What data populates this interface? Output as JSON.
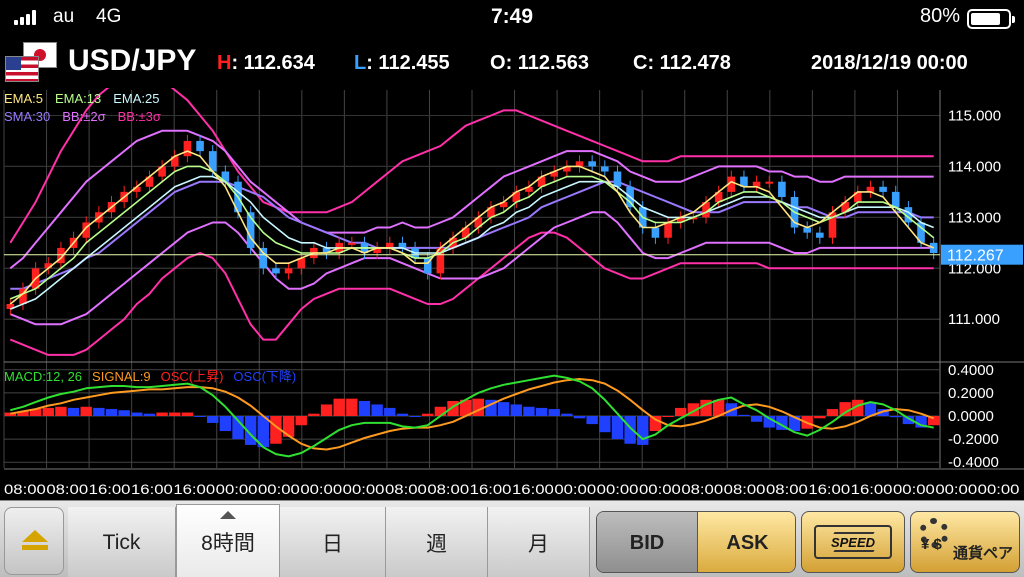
{
  "status_bar": {
    "carrier": "au",
    "network": "4G",
    "time": "7:49",
    "battery_percent": "80%",
    "battery_level": 0.8
  },
  "header": {
    "pair": "USD/JPY",
    "high_key": "H",
    "high": ": 112.634",
    "low_key": "L",
    "low": ": 112.455",
    "open_key": "O",
    "open": ": 112.563",
    "close_key": "C",
    "close": ": 112.478",
    "datetime": "2018/12/19 00:00",
    "colors": {
      "high": "#ff2020",
      "low": "#3aa0ff",
      "open": "#ffffff",
      "close": "#ffffff"
    }
  },
  "indicators": {
    "row1": [
      {
        "label": "EMA:5",
        "color": "#ffe680"
      },
      {
        "label": "EMA:13",
        "color": "#b8ff8c"
      },
      {
        "label": "EMA:25",
        "color": "#c8f8ff"
      }
    ],
    "row2": [
      {
        "label": "SMA:30",
        "color": "#9a78ff"
      },
      {
        "label": "BB:±2σ",
        "color": "#e070ff"
      },
      {
        "label": "BB:±3σ",
        "color": "#ff30a8"
      }
    ],
    "macd_legend": [
      {
        "label": "MACD:12, 26",
        "color": "#30e030"
      },
      {
        "label": "SIGNAL:9",
        "color": "#ff9a20"
      },
      {
        "label": "OSC(上昇)",
        "color": "#ff2020"
      },
      {
        "label": "OSC(下降)",
        "color": "#2040ff"
      }
    ]
  },
  "chart_data": {
    "type": "line",
    "price_axis": {
      "min": 110.2,
      "max": 115.5,
      "ticks": [
        "115.000",
        "114.000",
        "113.000",
        "112.000",
        "111.000"
      ],
      "tick_values": [
        115,
        114,
        113,
        112,
        111
      ]
    },
    "current_price": "112.267",
    "current_price_value": 112.267,
    "time_labels": [
      "08:00",
      "08:00",
      "16:00",
      "16:00",
      "16:00",
      "00:00",
      "00:00",
      "00:00",
      "00:00",
      "08:00",
      "08:00",
      "16:00",
      "16:00",
      "00:00",
      "00:00",
      "00:00",
      "08:00",
      "08:00",
      "08:00",
      "16:00",
      "16:00",
      "00:00",
      "00:00",
      "00:00"
    ],
    "close": [
      111.3,
      111.6,
      112.0,
      112.1,
      112.4,
      112.6,
      112.9,
      113.1,
      113.3,
      113.5,
      113.6,
      113.8,
      114.0,
      114.2,
      114.5,
      114.3,
      113.9,
      113.7,
      113.1,
      112.4,
      112.0,
      111.9,
      112.0,
      112.2,
      112.4,
      112.3,
      112.5,
      112.5,
      112.3,
      112.4,
      112.5,
      112.4,
      112.2,
      111.9,
      112.4,
      112.6,
      112.8,
      113.0,
      113.2,
      113.3,
      113.5,
      113.6,
      113.8,
      113.9,
      114.0,
      114.1,
      114.0,
      113.9,
      113.6,
      113.2,
      112.8,
      112.6,
      112.9,
      113.0,
      113.0,
      113.3,
      113.5,
      113.8,
      113.6,
      113.7,
      113.7,
      113.4,
      112.8,
      112.7,
      112.6,
      113.1,
      113.3,
      113.5,
      113.6,
      113.5,
      113.2,
      112.9,
      112.5,
      112.3
    ],
    "ema_5": [
      111.3,
      111.5,
      111.8,
      112.0,
      112.2,
      112.5,
      112.8,
      113.0,
      113.2,
      113.4,
      113.6,
      113.8,
      114.0,
      114.2,
      114.3,
      114.2,
      113.9,
      113.6,
      113.1,
      112.6,
      112.3,
      112.1,
      112.1,
      112.2,
      112.3,
      112.3,
      112.4,
      112.4,
      112.3,
      112.4,
      112.4,
      112.3,
      112.1,
      112.1,
      112.4,
      112.6,
      112.8,
      113.0,
      113.2,
      113.3,
      113.5,
      113.6,
      113.8,
      113.9,
      114.0,
      114.0,
      113.9,
      113.8,
      113.5,
      113.1,
      112.8,
      112.8,
      112.9,
      113.0,
      113.1,
      113.3,
      113.5,
      113.7,
      113.6,
      113.6,
      113.5,
      113.2,
      112.9,
      112.8,
      112.9,
      113.1,
      113.3,
      113.5,
      113.5,
      113.4,
      113.1,
      112.8,
      112.5,
      112.4
    ],
    "ema_13": [
      111.4,
      111.5,
      111.6,
      111.8,
      112.0,
      112.2,
      112.5,
      112.7,
      112.9,
      113.1,
      113.3,
      113.5,
      113.7,
      113.9,
      114.0,
      114.0,
      113.9,
      113.7,
      113.4,
      113.0,
      112.7,
      112.5,
      112.4,
      112.3,
      112.3,
      112.3,
      112.3,
      112.4,
      112.4,
      112.4,
      112.4,
      112.3,
      112.2,
      112.2,
      112.3,
      112.5,
      112.6,
      112.8,
      113.0,
      113.1,
      113.3,
      113.4,
      113.6,
      113.7,
      113.8,
      113.8,
      113.8,
      113.7,
      113.5,
      113.3,
      113.0,
      112.9,
      112.9,
      112.9,
      113.0,
      113.1,
      113.3,
      113.4,
      113.5,
      113.5,
      113.4,
      113.3,
      113.1,
      113.0,
      112.9,
      113.0,
      113.1,
      113.3,
      113.3,
      113.3,
      113.2,
      113.0,
      112.8,
      112.6
    ],
    "ema_25": [
      111.2,
      111.3,
      111.4,
      111.6,
      111.8,
      112.0,
      112.2,
      112.4,
      112.6,
      112.8,
      113.0,
      113.2,
      113.4,
      113.6,
      113.7,
      113.8,
      113.8,
      113.7,
      113.5,
      113.3,
      113.0,
      112.8,
      112.6,
      112.5,
      112.5,
      112.4,
      112.4,
      112.4,
      112.4,
      112.4,
      112.4,
      112.4,
      112.3,
      112.3,
      112.3,
      112.4,
      112.5,
      112.6,
      112.8,
      112.9,
      113.1,
      113.2,
      113.4,
      113.5,
      113.6,
      113.7,
      113.7,
      113.7,
      113.6,
      113.4,
      113.2,
      113.1,
      113.0,
      113.0,
      113.0,
      113.1,
      113.2,
      113.3,
      113.4,
      113.4,
      113.4,
      113.3,
      113.2,
      113.1,
      113.0,
      113.0,
      113.1,
      113.2,
      113.2,
      113.2,
      113.2,
      113.1,
      112.9,
      112.8
    ],
    "sma_30": [
      111.6,
      111.6,
      111.7,
      111.8,
      111.9,
      112.0,
      112.2,
      112.3,
      112.5,
      112.7,
      112.9,
      113.1,
      113.3,
      113.5,
      113.6,
      113.7,
      113.7,
      113.7,
      113.6,
      113.5,
      113.4,
      113.2,
      113.0,
      112.9,
      112.8,
      112.7,
      112.6,
      112.5,
      112.5,
      112.4,
      112.4,
      112.4,
      112.4,
      112.4,
      112.4,
      112.4,
      112.5,
      112.6,
      112.7,
      112.8,
      112.9,
      113.0,
      113.2,
      113.3,
      113.4,
      113.5,
      113.6,
      113.7,
      113.7,
      113.6,
      113.5,
      113.4,
      113.3,
      113.2,
      113.1,
      113.1,
      113.1,
      113.2,
      113.3,
      113.3,
      113.3,
      113.3,
      113.2,
      113.2,
      113.1,
      113.0,
      113.0,
      113.1,
      113.1,
      113.1,
      113.1,
      113.1,
      113.0,
      113.0
    ],
    "bb_plus2": [
      112.0,
      112.2,
      112.5,
      112.8,
      113.1,
      113.4,
      113.7,
      113.9,
      114.1,
      114.3,
      114.5,
      114.6,
      114.7,
      114.7,
      114.7,
      114.6,
      114.5,
      114.3,
      114.0,
      113.7,
      113.5,
      113.3,
      113.1,
      112.9,
      112.8,
      112.7,
      112.7,
      112.7,
      112.7,
      112.8,
      112.8,
      112.9,
      112.8,
      112.8,
      112.9,
      113.0,
      113.2,
      113.4,
      113.6,
      113.8,
      113.9,
      114.0,
      114.1,
      114.2,
      114.3,
      114.3,
      114.3,
      114.2,
      114.1,
      113.9,
      113.8,
      113.7,
      113.7,
      113.7,
      113.8,
      113.9,
      114.0,
      114.0,
      114.0,
      114.0,
      113.9,
      113.9,
      113.8,
      113.8,
      113.7,
      113.7,
      113.8,
      113.8,
      113.8,
      113.8,
      113.8,
      113.8,
      113.8,
      113.8
    ],
    "bb_minus2": [
      111.1,
      111.0,
      110.9,
      110.9,
      110.9,
      111.0,
      111.1,
      111.3,
      111.5,
      111.7,
      111.9,
      112.1,
      112.3,
      112.5,
      112.7,
      112.8,
      112.9,
      112.9,
      112.7,
      112.4,
      112.1,
      111.8,
      111.6,
      111.6,
      111.7,
      111.9,
      112.0,
      112.1,
      112.2,
      112.2,
      112.2,
      112.1,
      112.0,
      111.9,
      111.8,
      111.8,
      111.8,
      111.8,
      111.9,
      112.0,
      112.2,
      112.4,
      112.6,
      112.8,
      112.9,
      113.0,
      113.1,
      113.1,
      112.9,
      112.6,
      112.3,
      112.2,
      112.2,
      112.3,
      112.4,
      112.5,
      112.5,
      112.5,
      112.5,
      112.5,
      112.5,
      112.4,
      112.3,
      112.3,
      112.4,
      112.4,
      112.4,
      112.4,
      112.4,
      112.4,
      112.4,
      112.4,
      112.4,
      112.4
    ],
    "bb_plus3": [
      112.5,
      112.9,
      113.3,
      113.8,
      114.3,
      114.7,
      115.1,
      115.4,
      115.6,
      115.8,
      115.9,
      115.8,
      115.7,
      115.5,
      115.3,
      115.0,
      114.7,
      114.3,
      113.9,
      113.6,
      113.3,
      113.2,
      113.1,
      113.1,
      113.1,
      113.1,
      113.2,
      113.3,
      113.5,
      113.7,
      113.9,
      114.1,
      114.2,
      114.3,
      114.4,
      114.6,
      114.8,
      114.9,
      115.0,
      115.1,
      115.1,
      115.0,
      114.9,
      114.8,
      114.7,
      114.6,
      114.5,
      114.4,
      114.3,
      114.2,
      114.1,
      114.1,
      114.1,
      114.2,
      114.2,
      114.2,
      114.2,
      114.2,
      114.2,
      114.2,
      114.2,
      114.2,
      114.2,
      114.2,
      114.2,
      114.2,
      114.2,
      114.2,
      114.2,
      114.2,
      114.2,
      114.2,
      114.2,
      114.2
    ],
    "bb_minus3": [
      110.6,
      110.5,
      110.4,
      110.3,
      110.3,
      110.3,
      110.4,
      110.6,
      110.8,
      111.0,
      111.3,
      111.5,
      111.8,
      112.0,
      112.2,
      112.3,
      112.2,
      111.9,
      111.4,
      110.9,
      110.6,
      110.6,
      110.9,
      111.2,
      111.4,
      111.5,
      111.6,
      111.6,
      111.6,
      111.6,
      111.6,
      111.5,
      111.4,
      111.3,
      111.3,
      111.4,
      111.6,
      111.8,
      112.0,
      112.2,
      112.4,
      112.6,
      112.7,
      112.7,
      112.6,
      112.4,
      112.2,
      112.0,
      111.9,
      111.8,
      111.8,
      111.9,
      112.0,
      112.1,
      112.1,
      112.1,
      112.1,
      112.1,
      112.1,
      112.1,
      112.0,
      112.0,
      112.0,
      112.0,
      112.0,
      112.0,
      112.0,
      112.0,
      112.0,
      112.0,
      112.0,
      112.0,
      112.0,
      112.0
    ],
    "macd_axis": {
      "min": -0.45,
      "max": 0.45,
      "ticks": [
        "0.4000",
        "0.2000",
        "0.0000",
        "-0.2000",
        "-0.4000"
      ],
      "tick_values": [
        0.4,
        0.2,
        0.0,
        -0.2,
        -0.4
      ]
    },
    "macd": [
      0.05,
      0.08,
      0.12,
      0.16,
      0.19,
      0.21,
      0.24,
      0.25,
      0.26,
      0.26,
      0.25,
      0.25,
      0.26,
      0.27,
      0.28,
      0.25,
      0.18,
      0.08,
      -0.04,
      -0.16,
      -0.27,
      -0.33,
      -0.35,
      -0.32,
      -0.26,
      -0.19,
      -0.12,
      -0.08,
      -0.06,
      -0.06,
      -0.06,
      -0.09,
      -0.1,
      -0.08,
      0.0,
      0.08,
      0.14,
      0.2,
      0.24,
      0.27,
      0.29,
      0.31,
      0.33,
      0.35,
      0.33,
      0.3,
      0.24,
      0.14,
      0.02,
      -0.1,
      -0.2,
      -0.16,
      -0.08,
      -0.02,
      0.04,
      0.1,
      0.14,
      0.16,
      0.1,
      0.05,
      -0.02,
      -0.08,
      -0.14,
      -0.17,
      -0.12,
      -0.05,
      0.03,
      0.09,
      0.12,
      0.1,
      0.05,
      -0.02,
      -0.08,
      -0.1
    ],
    "signal": [
      0.02,
      0.04,
      0.06,
      0.09,
      0.11,
      0.14,
      0.16,
      0.18,
      0.2,
      0.21,
      0.22,
      0.23,
      0.23,
      0.24,
      0.25,
      0.25,
      0.24,
      0.21,
      0.16,
      0.09,
      0.0,
      -0.09,
      -0.17,
      -0.24,
      -0.28,
      -0.29,
      -0.27,
      -0.23,
      -0.19,
      -0.16,
      -0.13,
      -0.11,
      -0.1,
      -0.1,
      -0.08,
      -0.05,
      0.0,
      0.05,
      0.1,
      0.15,
      0.19,
      0.23,
      0.26,
      0.29,
      0.31,
      0.32,
      0.31,
      0.28,
      0.22,
      0.14,
      0.05,
      -0.03,
      -0.08,
      -0.09,
      -0.07,
      -0.04,
      0.0,
      0.05,
      0.09,
      0.1,
      0.08,
      0.04,
      -0.01,
      -0.06,
      -0.1,
      -0.11,
      -0.09,
      -0.05,
      0.0,
      0.04,
      0.06,
      0.05,
      0.02,
      -0.02
    ]
  },
  "tabs": [
    {
      "label": "Tick",
      "active": false
    },
    {
      "label": "8時間",
      "active": true
    },
    {
      "label": "日",
      "active": false
    },
    {
      "label": "週",
      "active": false
    },
    {
      "label": "月",
      "active": false
    }
  ],
  "buttons": {
    "bid": "BID",
    "ask": "ASK",
    "speed": "SPEED",
    "pair_symbols": "¥ $",
    "pair_label": "通貨ペア"
  }
}
